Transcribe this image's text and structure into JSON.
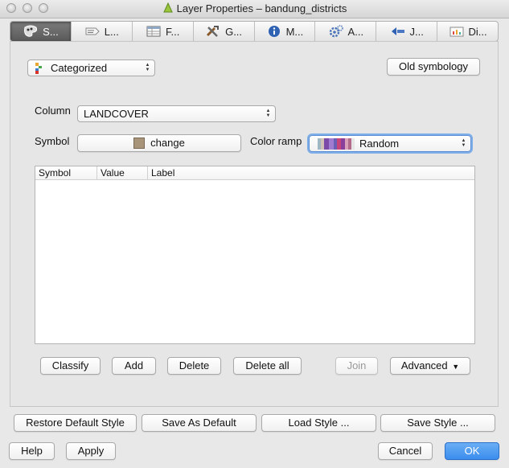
{
  "window": {
    "title": "Layer Properties – bandung_districts"
  },
  "tabs": [
    {
      "label": "S...",
      "icon": "style-icon",
      "active": true
    },
    {
      "label": "L...",
      "icon": "labels-icon",
      "active": false
    },
    {
      "label": "F...",
      "icon": "fields-icon",
      "active": false
    },
    {
      "label": "G...",
      "icon": "general-icon",
      "active": false
    },
    {
      "label": "M...",
      "icon": "metadata-icon",
      "active": false
    },
    {
      "label": "A...",
      "icon": "actions-icon",
      "active": false
    },
    {
      "label": "J...",
      "icon": "joins-icon",
      "active": false
    },
    {
      "label": "Di...",
      "icon": "diagrams-icon",
      "active": false
    }
  ],
  "style": {
    "renderer": "Categorized",
    "old_symbology": "Old symbology",
    "column_label": "Column",
    "column_value": "LANDCOVER",
    "symbol_label": "Symbol",
    "symbol_button": "change",
    "symbol_color": "#a89478",
    "color_ramp_label": "Color ramp",
    "color_ramp_value": "Random",
    "table_headers": {
      "symbol": "Symbol",
      "value": "Value",
      "label": "Label"
    },
    "buttons": {
      "classify": "Classify",
      "add": "Add",
      "delete": "Delete",
      "delete_all": "Delete all",
      "join": "Join",
      "advanced": "Advanced"
    }
  },
  "bottom": {
    "restore_default": "Restore Default Style",
    "save_as_default": "Save As Default",
    "load_style": "Load Style ...",
    "save_style": "Save Style ...",
    "help": "Help",
    "apply": "Apply",
    "cancel": "Cancel",
    "ok": "OK"
  },
  "colors": {
    "ok_button": "#3b8ded",
    "focus_ring": "#7eaee8"
  }
}
